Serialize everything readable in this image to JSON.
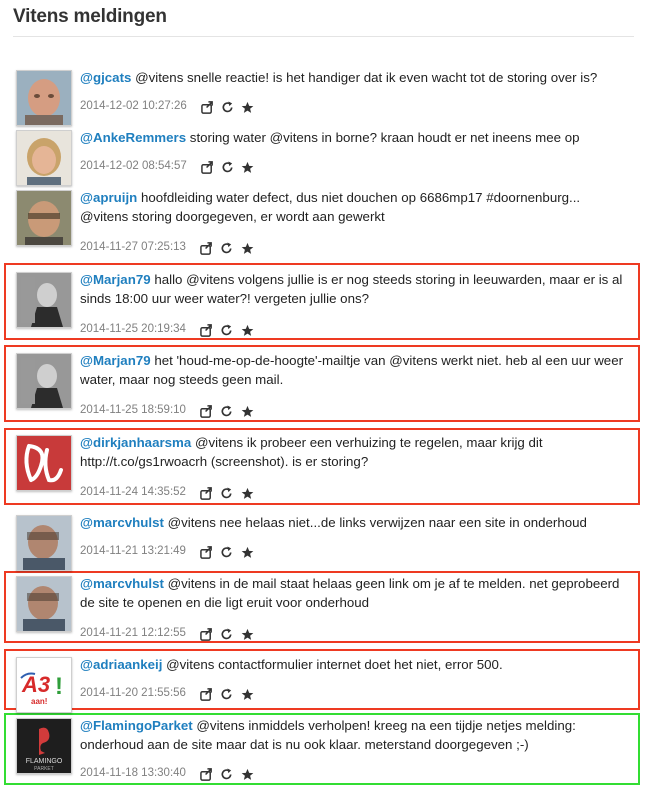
{
  "page": {
    "title": "Vitens meldingen"
  },
  "tweets": [
    {
      "handle": "@gjcats",
      "text": "@vitens snelle reactie! is het handiger dat ik even wacht tot de storing over is?",
      "time": "2014-12-02 10:27:26"
    },
    {
      "handle": "@AnkeRemmers",
      "text": "storing water @vitens in borne? kraan houdt er net ineens mee op",
      "time": "2014-12-02 08:54:57"
    },
    {
      "handle": "@apruijn",
      "text": "hoofdleiding water defect, dus niet douchen op 6686mp17 #doornenburg... @vitens storing doorgegeven, er wordt aan gewerkt",
      "time": "2014-11-27 07:25:13"
    },
    {
      "handle": "@Marjan79",
      "text": "hallo @vitens volgens jullie is er nog steeds storing in leeuwarden, maar er is al sinds 18:00 uur weer water?! vergeten jullie ons?",
      "time": "2014-11-25 20:19:34"
    },
    {
      "handle": "@Marjan79",
      "text": "het 'houd-me-op-de-hoogte'-mailtje van @vitens werkt niet. heb al een uur weer water, maar nog steeds geen mail.",
      "time": "2014-11-25 18:59:10"
    },
    {
      "handle": "@dirkjanhaarsma",
      "text": "@vitens ik probeer een verhuizing te regelen, maar krijg dit http://t.co/gs1rwoacrh (screenshot). is er storing?",
      "time": "2014-11-24 14:35:52"
    },
    {
      "handle": "@marcvhulst",
      "text": "@vitens nee helaas niet...de links verwijzen naar een site in onderhoud",
      "time": "2014-11-21 13:21:49"
    },
    {
      "handle": "@marcvhulst",
      "text": "@vitens in de mail staat helaas geen link om je af te melden. net geprobeerd de site te openen en die ligt eruit voor onderhoud",
      "time": "2014-11-21 12:12:55"
    },
    {
      "handle": "@adriaankeij",
      "text": "@vitens contactformulier internet doet het niet, error 500.",
      "time": "2014-11-20 21:55:56"
    },
    {
      "handle": "@FlamingoParket",
      "text": "@vitens inmiddels verholpen! kreeg na een tijdje netjes melding: onderhoud aan de site maar dat is nu ook klaar. meterstand doorgegeven ;-)",
      "time": "2014-11-18 13:30:40"
    }
  ],
  "logos": {
    "a3_text": "A3",
    "a3_sub": "aan!",
    "flamingo_text": "FLAMINGO",
    "flamingo_sub": "PARKET"
  },
  "icons": [
    "reply-icon",
    "retweet-icon",
    "favorite-icon"
  ],
  "colors": {
    "handle": "#1f7fbf",
    "highlight_red": "#ee3a22",
    "highlight_green": "#33dd33"
  }
}
